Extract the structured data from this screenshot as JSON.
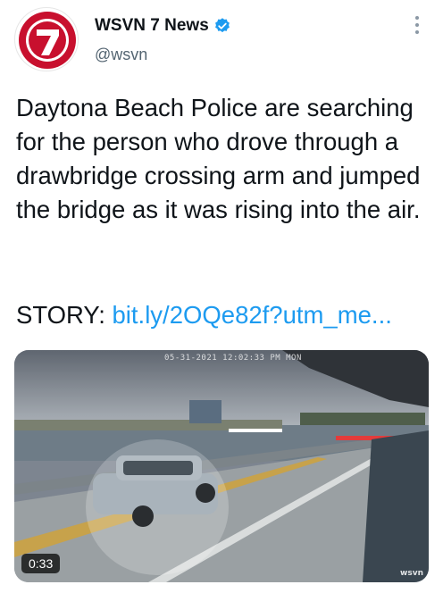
{
  "tweet": {
    "author": {
      "display_name": "WSVN 7 News",
      "handle": "@wsvn",
      "verified": true,
      "avatar_icon": "wsvn-7-logo"
    },
    "more_icon": "vertical-ellipsis-icon",
    "text": "Daytona Beach Police are searching for the person who drove through a drawbridge crossing arm and jumped the bridge as it was rising into the air.",
    "story_label": "STORY: ",
    "story_link": "bit.ly/2OQe82f?utm_me...",
    "media": {
      "type": "video",
      "duration": "0:33",
      "camera_stamp": "05-31-2021 12:02:33 PM MON",
      "watermark": "wsvn"
    }
  },
  "colors": {
    "link": "#1d9bf0",
    "verified": "#1d9bf0",
    "secondary_text": "#536471",
    "logo_red": "#c8102e"
  }
}
